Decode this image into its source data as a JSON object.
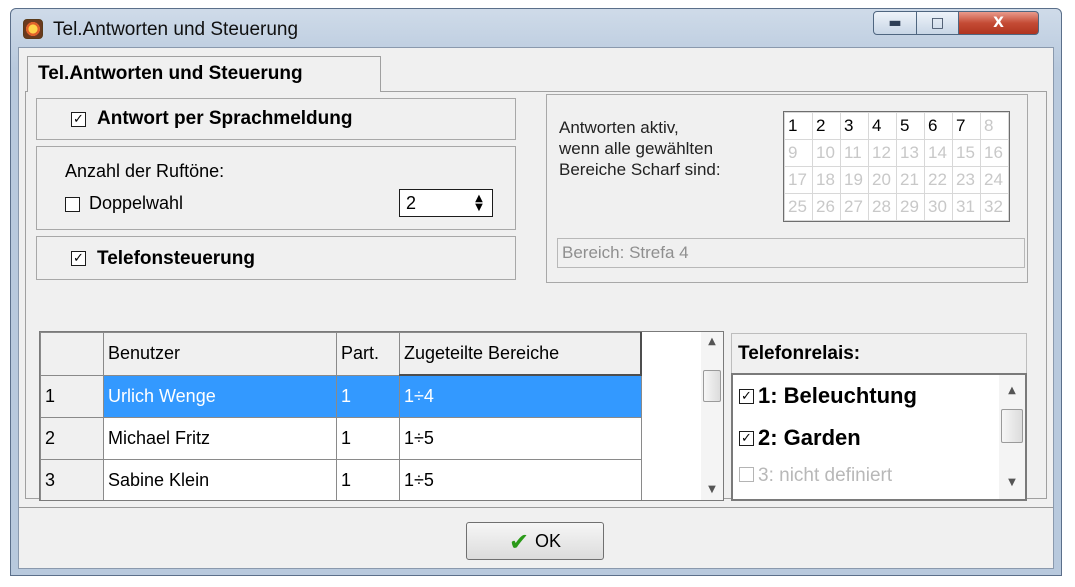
{
  "window": {
    "title": "Tel.Antworten und Steuerung",
    "icons": {
      "app": "app-logo-icon",
      "minimize": "minimize-icon",
      "maximize": "maximize-icon",
      "close": "close-icon"
    },
    "close_label": "X"
  },
  "tab": {
    "label": "Tel.Antworten und Steuerung"
  },
  "voice_answer": {
    "label": "Antwort per Sprachmeldung",
    "checked": true
  },
  "rings": {
    "label": "Anzahl der Ruftöne:",
    "value": "2"
  },
  "double_call": {
    "label": "Doppelwahl",
    "checked": false
  },
  "phone_control": {
    "label": "Telefonsteuerung",
    "checked": true
  },
  "partitions": {
    "description_lines": [
      "Antworten aktiv,",
      "wenn alle gewählten",
      "Bereiche Scharf sind:"
    ],
    "numbers": [
      [
        "1",
        "2",
        "3",
        "4",
        "5",
        "6",
        "7",
        "8"
      ],
      [
        "9",
        "10",
        "11",
        "12",
        "13",
        "14",
        "15",
        "16"
      ],
      [
        "17",
        "18",
        "19",
        "20",
        "21",
        "22",
        "23",
        "24"
      ],
      [
        "25",
        "26",
        "27",
        "28",
        "29",
        "30",
        "31",
        "32"
      ]
    ],
    "active_count": 7,
    "bereich_text": "Bereich: Strefa  4"
  },
  "users_table": {
    "headers": [
      "",
      "Benutzer",
      "Part.",
      "Zugeteilte Bereiche"
    ],
    "rows": [
      {
        "num": "1",
        "name": "Urlich Wenge",
        "part": "1",
        "areas": "1÷4",
        "selected": true
      },
      {
        "num": "2",
        "name": "Michael Fritz",
        "part": "1",
        "areas": "1÷5",
        "selected": false
      },
      {
        "num": "3",
        "name": "Sabine Klein",
        "part": "1",
        "areas": "1÷5",
        "selected": false
      }
    ]
  },
  "relays": {
    "title": "Telefonrelais:",
    "items": [
      {
        "label": "1: Beleuchtung",
        "checked": true,
        "enabled": true
      },
      {
        "label": "2: Garden",
        "checked": true,
        "enabled": true
      },
      {
        "label": "3: nicht definiert",
        "checked": false,
        "enabled": false
      }
    ]
  },
  "ok_button": {
    "label": "OK",
    "icon": "checkmark-icon",
    "icon_color": "#2a9a18"
  },
  "colors": {
    "selection": "#3399ff",
    "close_button": "#c44b35"
  }
}
